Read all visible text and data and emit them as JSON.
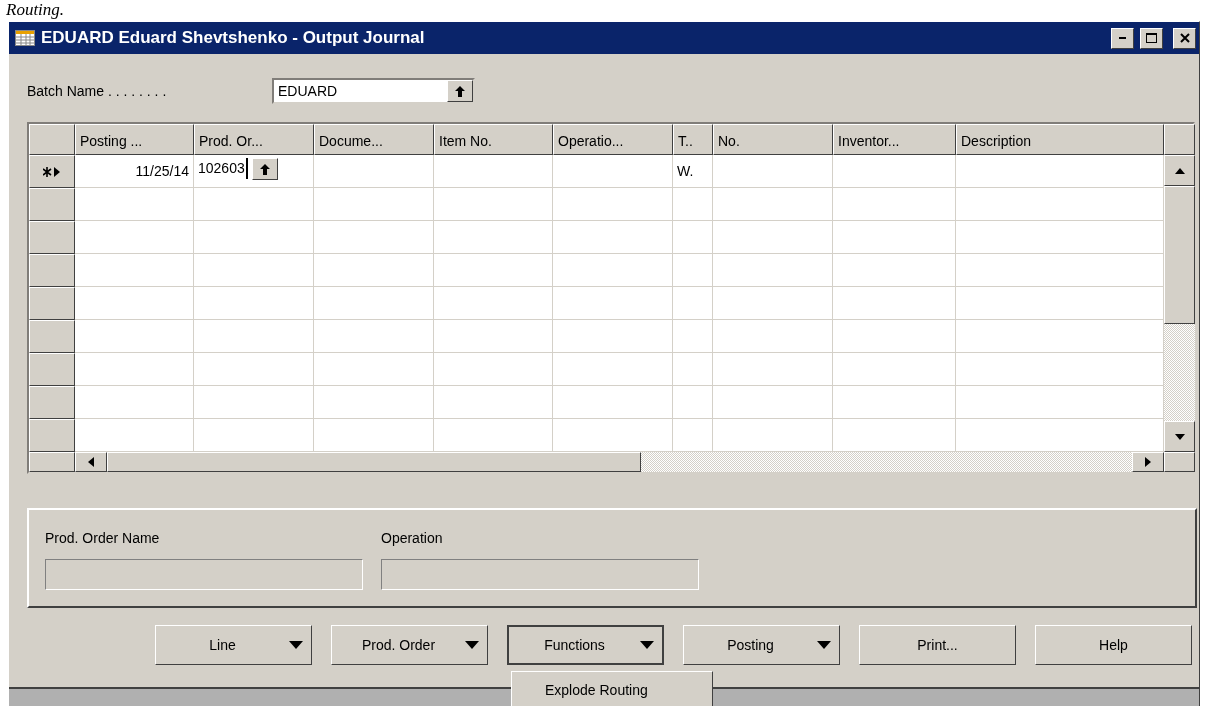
{
  "caption_fragment": "Routing.",
  "window": {
    "title": "EDUARD Eduard Shevtshenko - Output Journal"
  },
  "batch": {
    "label": "Batch Name . . . . . . . .",
    "value": "EDUARD"
  },
  "table": {
    "columns": [
      {
        "label": "Posting ..."
      },
      {
        "label": "Prod. Or..."
      },
      {
        "label": "Docume..."
      },
      {
        "label": "Item No."
      },
      {
        "label": "Operatio..."
      },
      {
        "label": "T.."
      },
      {
        "label": "No."
      },
      {
        "label": "Inventor..."
      },
      {
        "label": "Description"
      }
    ],
    "rows": [
      {
        "current": true,
        "cells": [
          {
            "text": "11/25/14",
            "kind": "date"
          },
          {
            "text": "102603",
            "kind": "code",
            "lookup": true,
            "editing": true
          },
          {},
          {},
          {},
          {
            "text": "W.",
            "kind": "code"
          },
          {},
          {},
          {}
        ]
      },
      {
        "current": false,
        "cells": []
      },
      {
        "current": false,
        "cells": []
      },
      {
        "current": false,
        "cells": []
      },
      {
        "current": false,
        "cells": []
      },
      {
        "current": false,
        "cells": []
      },
      {
        "current": false,
        "cells": []
      },
      {
        "current": false,
        "cells": []
      },
      {
        "current": false,
        "cells": []
      }
    ]
  },
  "info": {
    "fields": [
      {
        "label": "Prod. Order Name"
      },
      {
        "label": "Operation"
      }
    ]
  },
  "buttons": [
    {
      "label": "Line",
      "dropdown": true,
      "focused": false
    },
    {
      "label": "Prod. Order",
      "dropdown": true,
      "focused": false
    },
    {
      "label": "Functions",
      "dropdown": true,
      "focused": true
    },
    {
      "label": "Posting",
      "dropdown": true,
      "focused": false
    },
    {
      "label": "Print...",
      "dropdown": false,
      "focused": false
    },
    {
      "label": "Help",
      "dropdown": false,
      "focused": false
    }
  ],
  "menu": {
    "items": [
      "Explode Routing"
    ]
  }
}
